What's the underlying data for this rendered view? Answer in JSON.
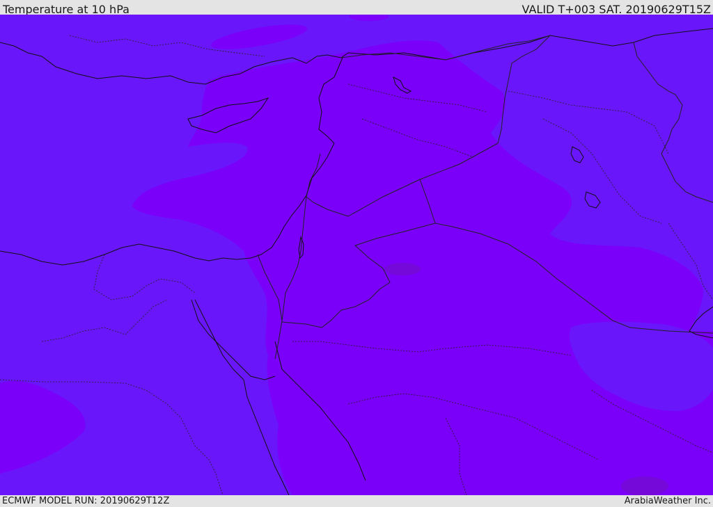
{
  "header": {
    "title": "Temperature at 10 hPa",
    "valid_time": "VALID T+003 SAT. 20190629T15Z"
  },
  "footer": {
    "model_run": "ECMWF MODEL RUN: 20190629T12Z",
    "credit": "ArabiaWeather Inc."
  },
  "map": {
    "colors": {
      "cool_band": "#6a16fa",
      "warm_band": "#7b00fa",
      "warmest_spot": "#7409da",
      "coastline": "#111111",
      "borders": "#222222"
    }
  }
}
